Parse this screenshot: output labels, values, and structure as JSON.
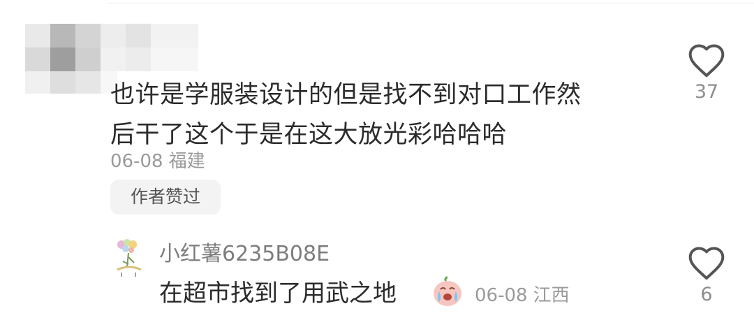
{
  "comment": {
    "text_line1": "也许是学服装设计的但是找不到对口工作然",
    "text_line2": "后干了这个于是在这大放光彩哈哈哈",
    "date": "06-08",
    "location": "福建",
    "author_liked_label": "作者赞过",
    "like_count": "37",
    "like_icon": "heart-outline-icon"
  },
  "reply": {
    "username": "小红薯6235B08E",
    "text": "在超市找到了用武之地",
    "emoji_icon": "crying-face-emoji-icon",
    "date": "06-08",
    "location": "江西",
    "like_count": "6",
    "like_icon": "heart-outline-icon"
  },
  "colors": {
    "text_primary": "#2b2b2b",
    "text_secondary": "#9a9a9a",
    "badge_bg": "#f3f3f3",
    "heart_stroke": "#555555"
  }
}
